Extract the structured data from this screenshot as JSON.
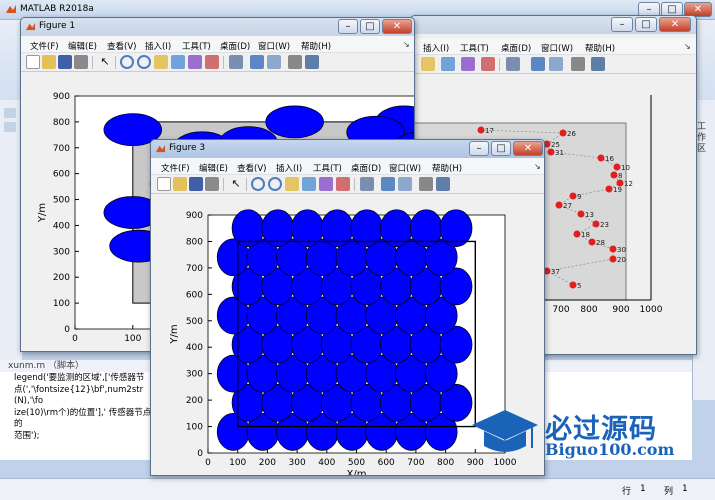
{
  "main_window": {
    "title": "MATLAB R2018a",
    "side_panel_label": "工作区",
    "editor_tab": "xunm.m （脚本）",
    "code_lines": [
      "legend('要监测的区域',['传感器节",
      "点(','\\fontsize{12}\\bf',num2str(N),'\\fo",
      "ize(10)\\rm个)的位置'],' 传感器节点的",
      "范围');"
    ],
    "status": {
      "row_label": "行",
      "row_value": "1",
      "col_label": "列",
      "col_value": "1"
    }
  },
  "window_buttons": {
    "minimize": "–",
    "maximize": "□",
    "close": "✕"
  },
  "figure1": {
    "title": "Figure 1",
    "menu": [
      "文件(F)",
      "编辑(E)",
      "查看(V)",
      "插入(I)",
      "工具(T)",
      "桌面(D)",
      "窗口(W)",
      "帮助(H)"
    ],
    "ylabel": "Y/m",
    "yticks": [
      "0",
      "100",
      "200",
      "300",
      "400",
      "500",
      "600",
      "700",
      "800",
      "900"
    ],
    "xticks": [
      "0",
      "100",
      "200"
    ]
  },
  "figure2": {
    "menu": [
      "插入(I)",
      "工具(T)",
      "桌面(D)",
      "窗口(W)",
      "帮助(H)"
    ],
    "xticks": [
      "700",
      "800",
      "900",
      "1000"
    ],
    "node_labels": [
      "17",
      "26",
      "25",
      "31",
      "16",
      "10",
      "8",
      "12",
      "19",
      "9",
      "27",
      "13",
      "23",
      "18",
      "28",
      "30",
      "20",
      "37",
      "5"
    ]
  },
  "figure3": {
    "title": "Figure 3",
    "menu": [
      "文件(F)",
      "编辑(E)",
      "查看(V)",
      "插入(I)",
      "工具(T)",
      "桌面(D)",
      "窗口(W)",
      "帮助(H)"
    ],
    "xlabel": "X/m",
    "ylabel": "Y/m",
    "xticks": [
      "0",
      "100",
      "200",
      "300",
      "400",
      "500",
      "600",
      "700",
      "800",
      "900",
      "1000"
    ],
    "yticks": [
      "0",
      "100",
      "200",
      "300",
      "400",
      "500",
      "600",
      "700",
      "800",
      "900"
    ]
  },
  "watermark": {
    "cn": "必过源码",
    "en": "Biguo100.com"
  },
  "colors": {
    "circle": "#0000ff",
    "region": "#c8c8c8",
    "node": "#e02020",
    "watermark": "#1a63b8"
  }
}
